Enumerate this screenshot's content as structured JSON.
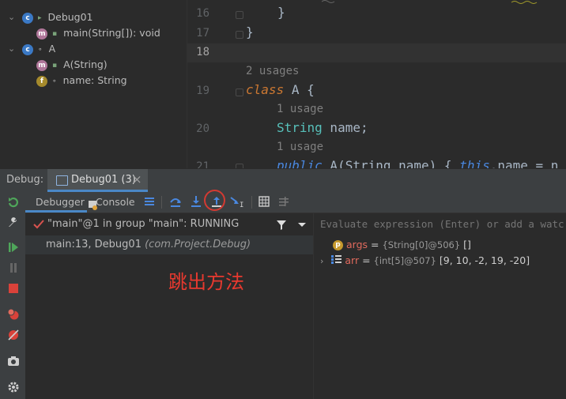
{
  "structure": {
    "items": [
      {
        "label": "Debug01",
        "kind": "class",
        "level": 0,
        "expanded": true
      },
      {
        "label": "main(String[]): void",
        "kind": "method",
        "level": 1
      },
      {
        "label": "A",
        "kind": "class",
        "level": 0,
        "expanded": true
      },
      {
        "label": "A(String)",
        "kind": "method",
        "level": 1
      },
      {
        "label": "name: String",
        "kind": "field",
        "level": 1
      }
    ]
  },
  "editor": {
    "lines": [
      {
        "num": "16",
        "text": "}"
      },
      {
        "num": "17",
        "text": "}"
      },
      {
        "num": "18",
        "text": ""
      },
      {
        "num": "19",
        "hint": "2 usages",
        "kw": "class",
        "name": "A",
        "rest": " {"
      },
      {
        "num": "20",
        "hint": "1 usage",
        "type": "String",
        "rest": " name;"
      },
      {
        "num": "21",
        "hint": "1 usage",
        "kw": "public",
        "rest_text": " A(String name) { ",
        "kw2": "this",
        "tail": ".name = n"
      }
    ]
  },
  "debug_bar": {
    "label": "Debug:",
    "tab_title": "Debug01 (3)",
    "close_symbol": "×"
  },
  "subtabs": {
    "debugger": "Debugger",
    "console": "Console"
  },
  "toolbar_icons": [
    "show-execution-point-icon",
    "step-over-icon",
    "step-into-icon",
    "step-out-icon",
    "run-to-cursor-icon",
    "evaluate-icon",
    "trace-icon"
  ],
  "frames": {
    "thread_text": "\"main\"@1 in group \"main\": RUNNING",
    "frame_method": "main:13, Debug01",
    "frame_location": "(com.Project.Debug)"
  },
  "variables": {
    "placeholder": "Evaluate expression (Enter) or add a watch (Ctrl+Shift+Enter)",
    "items": [
      {
        "name": "args",
        "type": "{String[0]@506}",
        "value": "[]"
      },
      {
        "name": "arr",
        "type": "{int[5]@507}",
        "value": "[9, 10, -2, 19, -20]"
      }
    ]
  },
  "annotation": "跳出方法",
  "colors": {
    "accent": "#4a88c7",
    "annotation": "#e8392f",
    "keyword": "#cc7832"
  }
}
